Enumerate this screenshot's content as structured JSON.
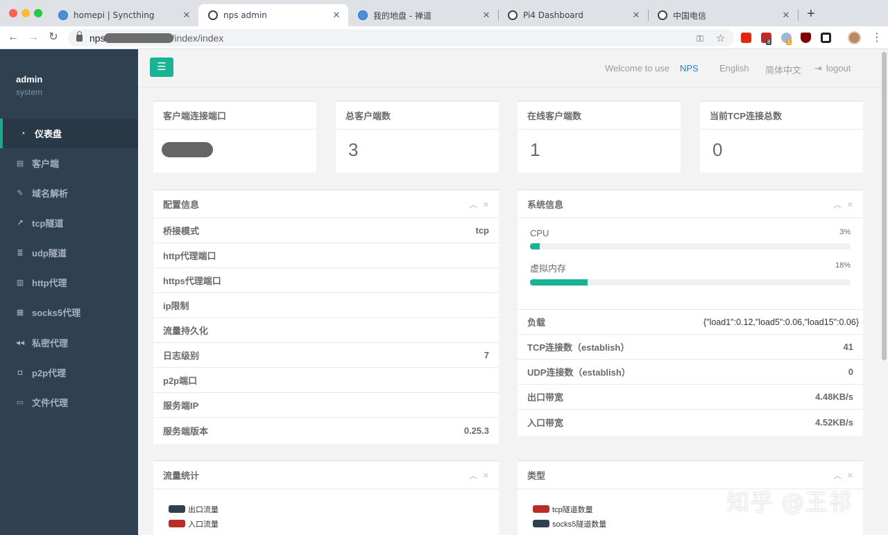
{
  "browser": {
    "tabs": [
      {
        "label": "homepi | Syncthing",
        "icon": "globe-blue"
      },
      {
        "label": "nps admin",
        "icon": "globe-dark",
        "active": true
      },
      {
        "label": "我的地盘 - 禅道",
        "icon": "globe-blue"
      },
      {
        "label": "Pi4 Dashboard",
        "icon": "globe-dark"
      },
      {
        "label": "中国电信",
        "icon": "globe-dark"
      }
    ],
    "close_glyph": "✕",
    "new_tab_glyph": "+",
    "url": {
      "host": "nps",
      "path": "/index/index"
    },
    "extension_badges": [
      "8",
      "1"
    ]
  },
  "sidebar": {
    "user_name": "admin",
    "user_role": "system",
    "items": [
      {
        "label": "仪表盘",
        "icon": "dashboard-icon",
        "glyph": "◔",
        "active": true
      },
      {
        "label": "客户端",
        "icon": "clipboard-icon",
        "glyph": "▤"
      },
      {
        "label": "域名解析",
        "icon": "paperclip-icon",
        "glyph": "✎"
      },
      {
        "label": "tcp隧道",
        "icon": "line-chart-icon",
        "glyph": "↗"
      },
      {
        "label": "udp隧道",
        "icon": "list-icon",
        "glyph": "≣"
      },
      {
        "label": "http代理",
        "icon": "file-icon",
        "glyph": "▥"
      },
      {
        "label": "socks5代理",
        "icon": "table-icon",
        "glyph": "▦"
      },
      {
        "label": "私密代理",
        "icon": "backward-icon",
        "glyph": "◀◀"
      },
      {
        "label": "p2p代理",
        "icon": "external-link-icon",
        "glyph": "◘"
      },
      {
        "label": "文件代理",
        "icon": "laptop-icon",
        "glyph": "▭"
      }
    ]
  },
  "topbar": {
    "menu_glyph": "☰",
    "welcome": "Welcome to use",
    "brand": "NPS",
    "lang_en": "English",
    "lang_zh": "简体中文",
    "logout": "logout",
    "logout_glyph": "⇥"
  },
  "stats": [
    {
      "title": "客户端连接端口",
      "value": null,
      "redacted": true
    },
    {
      "title": "总客户端数",
      "value": "3"
    },
    {
      "title": "在线客户端数",
      "value": "1"
    },
    {
      "title": "当前TCP连接总数",
      "value": "0"
    }
  ],
  "card_tool_glyphs": {
    "collapse": "︿",
    "close": "✕"
  },
  "config": {
    "title": "配置信息",
    "rows": [
      {
        "label": "桥接模式",
        "value": "tcp"
      },
      {
        "label": "http代理端口",
        "value": ""
      },
      {
        "label": "https代理端口",
        "value": ""
      },
      {
        "label": "ip限制",
        "value": ""
      },
      {
        "label": "流量持久化",
        "value": ""
      },
      {
        "label": "日志级别",
        "value": "7"
      },
      {
        "label": "p2p端口",
        "value": ""
      },
      {
        "label": "服务端IP",
        "value": ""
      },
      {
        "label": "服务端版本",
        "value": "0.25.3"
      }
    ]
  },
  "system": {
    "title": "系统信息",
    "progress": [
      {
        "label": "CPU",
        "percent_text": "3%",
        "percent": 3
      },
      {
        "label": "虚拟内存",
        "percent_text": "18%",
        "percent": 18
      }
    ],
    "rows": [
      {
        "label": "负载",
        "value": "{\"load1\":0.12,\"load5\":0.06,\"load15\":0.06}"
      },
      {
        "label": "TCP连接数（establish）",
        "value": "41"
      },
      {
        "label": "UDP连接数（establish）",
        "value": "0"
      },
      {
        "label": "出口带宽",
        "value": "4.48KB/s"
      },
      {
        "label": "入口带宽",
        "value": "4.52KB/s"
      }
    ]
  },
  "traffic": {
    "title": "流量统计",
    "legend": [
      {
        "label": "出口流量",
        "color": "#2f4050"
      },
      {
        "label": "入口流量",
        "color": "#b92c28"
      }
    ]
  },
  "types": {
    "title": "类型",
    "legend": [
      {
        "label": "tcp隧道数量",
        "color": "#b92c28"
      },
      {
        "label": "socks5隧道数量",
        "color": "#2f4050"
      }
    ]
  },
  "watermark": "知乎 @王祁"
}
